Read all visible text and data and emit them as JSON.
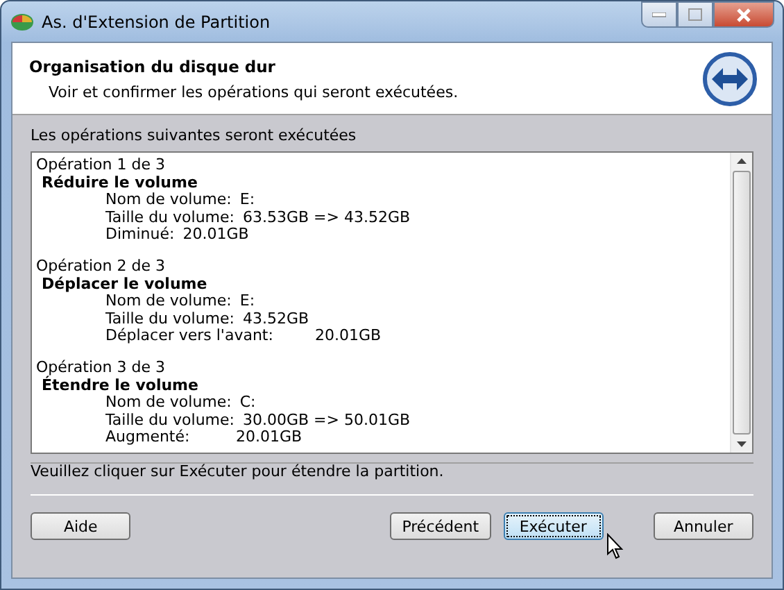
{
  "window": {
    "title": "As. d'Extension de Partition"
  },
  "header": {
    "title": "Organisation du disque dur",
    "subtitle": "Voir et confirmer les opérations qui seront exécutées."
  },
  "list_label": "Les opérations suivantes seront exécutées",
  "operations": [
    {
      "counter": "Opération 1 de 3",
      "title": "Réduire le volume",
      "details": [
        {
          "kind": "column",
          "label": "Nom de volume:",
          "value": "E:"
        },
        {
          "kind": "column",
          "label": "Taille du volume:",
          "value": "63.53GB => 43.52GB"
        },
        {
          "kind": "inline",
          "label": "Diminué:",
          "value": "20.01GB"
        }
      ]
    },
    {
      "counter": "Opération 2 de 3",
      "title": "Déplacer le volume",
      "details": [
        {
          "kind": "column",
          "label": "Nom de volume:",
          "value": "E:"
        },
        {
          "kind": "column",
          "label": "Taille du volume:",
          "value": "43.52GB"
        },
        {
          "kind": "wide",
          "label": "Déplacer vers l'avant:",
          "value": "20.01GB"
        }
      ]
    },
    {
      "counter": "Opération 3 de 3",
      "title": "Étendre le volume",
      "details": [
        {
          "kind": "column",
          "label": "Nom de volume:",
          "value": "C:"
        },
        {
          "kind": "column",
          "label": "Taille du volume:",
          "value": "30.00GB => 50.01GB"
        },
        {
          "kind": "column",
          "label": "Augmenté:",
          "value": "20.01GB"
        }
      ]
    }
  ],
  "hint": "Veuillez cliquer sur Exécuter pour étendre la partition.",
  "buttons": [
    {
      "label": "Aide",
      "selected": false
    },
    {
      "label": "Précédent",
      "selected": false
    },
    {
      "label": "Exécuter",
      "selected": true
    },
    {
      "label": "Annuler",
      "selected": false
    }
  ]
}
